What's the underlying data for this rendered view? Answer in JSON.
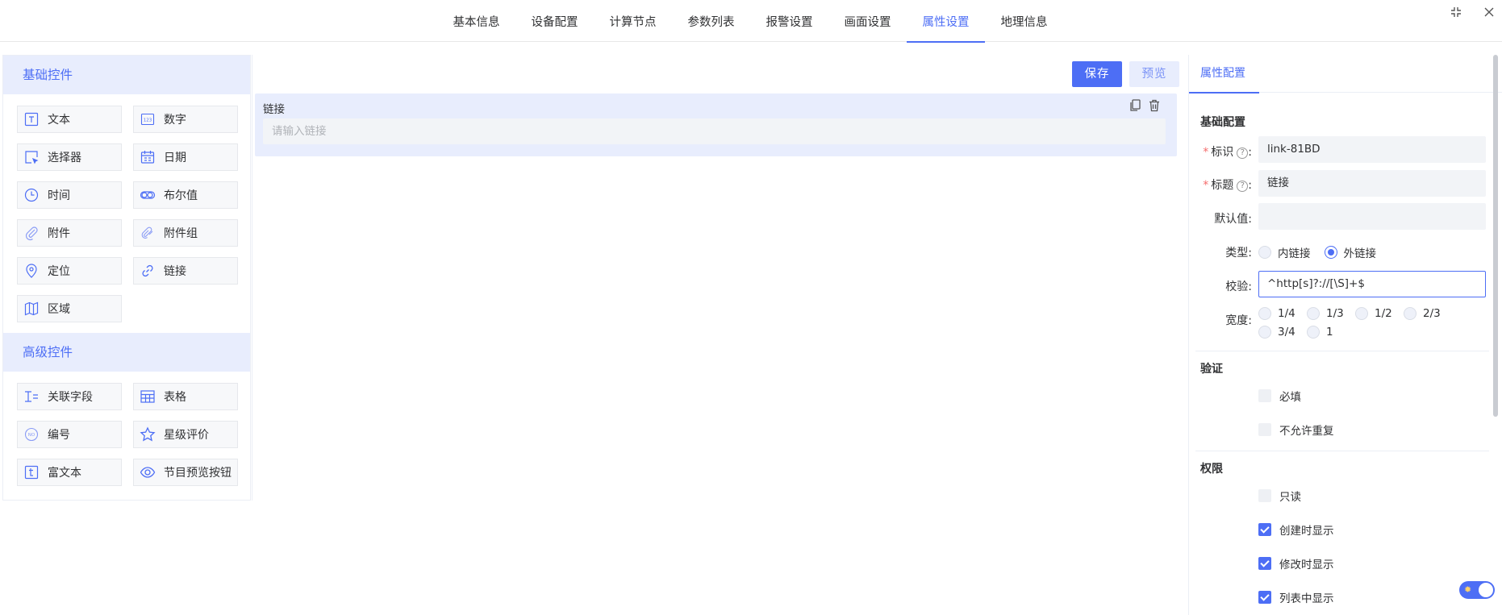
{
  "tabs": [
    "基本信息",
    "设备配置",
    "计算节点",
    "参数列表",
    "报警设置",
    "画面设置",
    "属性设置",
    "地理信息"
  ],
  "active_tab": "属性设置",
  "window": {
    "fullscreen_icon": "compress-icon",
    "close_icon": "close-icon"
  },
  "palette": {
    "basic_title": "基础控件",
    "basic_items": [
      {
        "label": "文本",
        "icon": "text-icon"
      },
      {
        "label": "数字",
        "icon": "number-icon"
      },
      {
        "label": "选择器",
        "icon": "select-icon"
      },
      {
        "label": "日期",
        "icon": "calendar-icon"
      },
      {
        "label": "时间",
        "icon": "clock-icon"
      },
      {
        "label": "布尔值",
        "icon": "toggle-icon"
      },
      {
        "label": "附件",
        "icon": "paperclip-icon"
      },
      {
        "label": "附件组",
        "icon": "paperclip-group-icon"
      },
      {
        "label": "定位",
        "icon": "location-pin-icon"
      },
      {
        "label": "链接",
        "icon": "link-icon"
      },
      {
        "label": "区域",
        "icon": "map-icon"
      }
    ],
    "advanced_title": "高级控件",
    "advanced_items": [
      {
        "label": "关联字段",
        "icon": "relation-field-icon"
      },
      {
        "label": "表格",
        "icon": "table-icon"
      },
      {
        "label": "编号",
        "icon": "serial-number-icon"
      },
      {
        "label": "星级评价",
        "icon": "star-icon"
      },
      {
        "label": "富文本",
        "icon": "rich-text-icon"
      },
      {
        "label": "节目预览按钮",
        "icon": "eye-icon"
      }
    ]
  },
  "canvas": {
    "save_label": "保存",
    "preview_label": "预览",
    "field": {
      "label": "链接",
      "placeholder": "请输入链接"
    }
  },
  "props": {
    "tab": "属性配置",
    "basic_section": "基础配置",
    "id_label": "标识",
    "id_value": "link-81BD",
    "title_label": "标题",
    "title_value": "链接",
    "default_label": "默认值:",
    "default_value": "",
    "colon": ":",
    "type_label": "类型:",
    "type_options": [
      "内链接",
      "外链接"
    ],
    "type_selected": "外链接",
    "validate_label": "校验:",
    "validate_value": "^http[s]?://[\\S]+$",
    "width_label": "宽度:",
    "width_options": [
      "1/4",
      "1/3",
      "1/2",
      "2/3",
      "3/4",
      "1"
    ],
    "validation_section": "验证",
    "validation_items": [
      {
        "label": "必填",
        "checked": false
      },
      {
        "label": "不允许重复",
        "checked": false
      }
    ],
    "permission_section": "权限",
    "permission_items": [
      {
        "label": "只读",
        "checked": false
      },
      {
        "label": "创建时显示",
        "checked": true
      },
      {
        "label": "修改时显示",
        "checked": true
      },
      {
        "label": "列表中显示",
        "checked": true
      }
    ]
  },
  "theme": {
    "accent": "#4d6ef5",
    "accent_light": "#e8edfd"
  }
}
